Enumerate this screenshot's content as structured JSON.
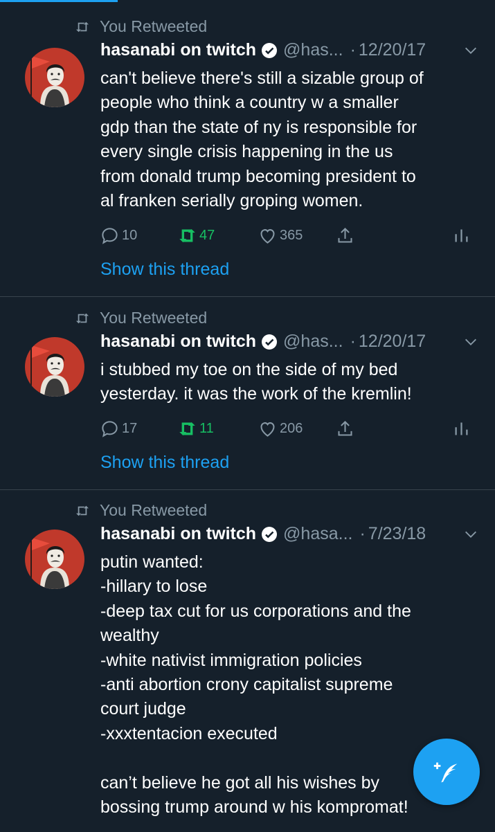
{
  "tweets": [
    {
      "retweet_label": "You Retweeted",
      "name": "hasanabi on twitch",
      "handle": "@has...",
      "sep": "·",
      "date": "12/20/17",
      "text": "can't believe there's still a sizable group of\npeople who think a country w a smaller\ngdp than the state of ny is responsible for\nevery single crisis happening in the us\nfrom donald trump becoming president to\nal franken serially groping women.",
      "replies": "10",
      "retweets": "47",
      "likes": "365",
      "show_thread": "Show this thread"
    },
    {
      "retweet_label": "You Retweeted",
      "name": "hasanabi on twitch",
      "handle": "@has...",
      "sep": "·",
      "date": "12/20/17",
      "text": "i stubbed my toe on the side of my bed\nyesterday. it was the work of the kremlin!",
      "replies": "17",
      "retweets": "11",
      "likes": "206",
      "show_thread": "Show this thread"
    },
    {
      "retweet_label": "You Retweeted",
      "name": "hasanabi on twitch",
      "handle": "@hasa...",
      "sep": "·",
      "date": "7/23/18",
      "text": "putin wanted:\n-hillary to lose\n-deep tax cut for us corporations and the\nwealthy\n-white nativist immigration policies\n-anti abortion crony capitalist supreme\ncourt judge\n-xxxtentacion executed\n\ncan’t believe he got all his wishes by\nbossing trump around w his kompromat!"
    }
  ],
  "fab": {
    "icon": "compose-tweet-icon"
  },
  "colors": {
    "background": "#15202b",
    "accent": "#1da1f2",
    "retweet_green": "#17bf63",
    "muted": "#8899a6",
    "divider": "#38444d"
  }
}
